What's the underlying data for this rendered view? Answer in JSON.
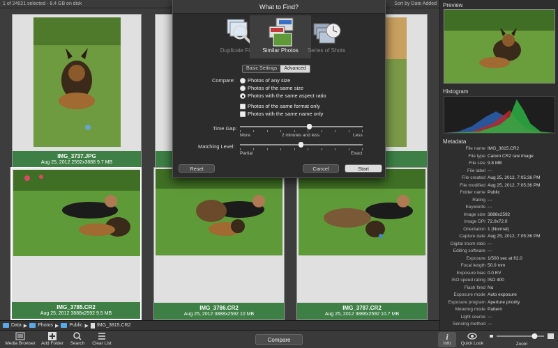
{
  "topbar": {
    "status": "1 of 24021 selected - 8.4 GB on disk",
    "sort": "Sort by Date Added"
  },
  "photos": [
    {
      "name": "IMG_3737.JPG",
      "info": "Aug 25, 2012   2592x3888   9.7 MB"
    },
    {
      "name": "IMG_3785.CR2",
      "info": "Aug 25, 2012   3888x2592   9.5 MB"
    },
    {
      "name": "IMG_3786.CR2",
      "info": "Aug 25, 2012   3888x2592   10 MB"
    },
    {
      "name": "IMG_3787.CR2",
      "info": "Aug 25, 2012   3888x2592   10.7 MB"
    }
  ],
  "dialog": {
    "title": "What to Find?",
    "modes": [
      "Duplicate Files",
      "Similar Photos",
      "Series of Shots"
    ],
    "tabs": [
      "Basic Settings",
      "Advanced"
    ],
    "compare_label": "Compare:",
    "radios": [
      "Photos of any size",
      "Photos of the same size",
      "Photos with the same aspect ratio"
    ],
    "checks": [
      "Photos of the same format only",
      "Photos with the same name only"
    ],
    "time_gap_label": "Time Gap:",
    "time_more": "More",
    "time_value": "2 minutes and less",
    "time_less": "Less",
    "matching_label": "Matching Level:",
    "match_partial": "Partial",
    "match_exact": "Exact",
    "reset": "Reset",
    "cancel": "Cancel",
    "start": "Start"
  },
  "side": {
    "preview": "Preview",
    "histogram": "Histogram",
    "metadata": "Metadata",
    "rows": [
      [
        "File name",
        "IMG_3815.CR2"
      ],
      [
        "File type",
        "Canon CR2 raw image"
      ],
      [
        "File size",
        "9.8 MB"
      ],
      [
        "File label",
        "---"
      ],
      [
        "File created",
        "Aug 25, 2012, 7:05:36 PM"
      ],
      [
        "File modified",
        "Aug 25, 2012, 7:05:36 PM"
      ],
      [
        "Folder name",
        "Public"
      ],
      [
        "Rating",
        "---"
      ],
      [
        "Keywords",
        "---"
      ],
      [
        "Image size",
        "3888x2592"
      ],
      [
        "Image DPI",
        "72.0x72.0"
      ],
      [
        "Orientation",
        "1 (Normal)"
      ],
      [
        "Capture date",
        "Aug 25, 2012, 7:05:36 PM"
      ],
      [
        "Digital zoom ratio",
        "---"
      ],
      [
        "Editing software",
        "---"
      ],
      [
        "Exposure",
        "1/500 sec at f/2.0"
      ],
      [
        "Focal length",
        "50.0 mm"
      ],
      [
        "Exposure bias",
        "0.0 EV"
      ],
      [
        "ISO speed rating",
        "ISO 400"
      ],
      [
        "Flash fired",
        "No"
      ],
      [
        "Exposure mode",
        "Auto exposure"
      ],
      [
        "Exposure program",
        "Aperture priority"
      ],
      [
        "Metering mode",
        "Pattern"
      ],
      [
        "Light source",
        "---"
      ],
      [
        "Sensing method",
        "---"
      ]
    ]
  },
  "path": {
    "p1": "Data",
    "p2": "Photos",
    "p3": "Public",
    "p4": "IMG_3815.CR2"
  },
  "toolbar": {
    "media_browser": "Media Browser",
    "add_folder": "Add Folder",
    "search": "Search",
    "clear_list": "Clear List",
    "compare": "Compare",
    "info": "Info",
    "quick_look": "Quick Look",
    "zoom": "Zoom"
  },
  "zoom_level": 0.8
}
